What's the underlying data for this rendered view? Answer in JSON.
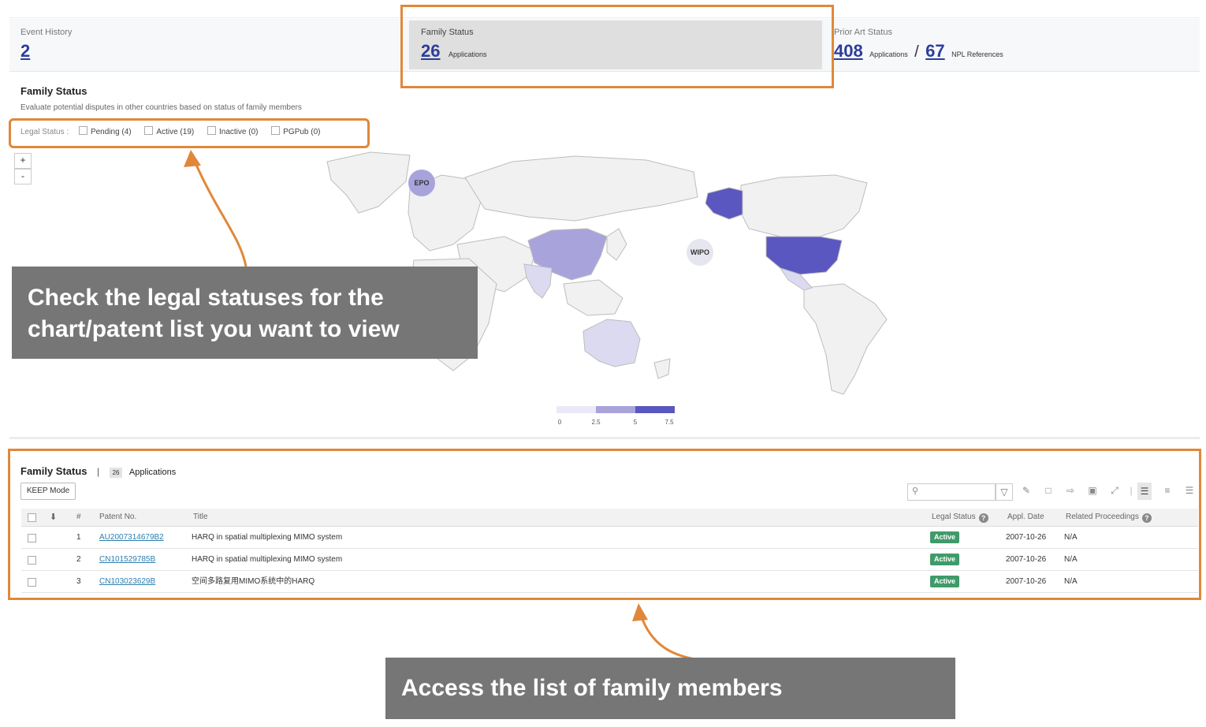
{
  "stats": {
    "event_history": {
      "label": "Event History",
      "value": "2"
    },
    "family_status": {
      "label": "Family Status",
      "value": "26",
      "unit": "Applications"
    },
    "prior_art": {
      "label": "Prior Art Status",
      "apps_value": "408",
      "apps_unit": "Applications",
      "separator": "/",
      "npl_value": "67",
      "npl_unit": "NPL References"
    }
  },
  "section": {
    "title": "Family Status",
    "description": "Evaluate potential disputes in other countries based on status of family members",
    "legal_label": "Legal Status :",
    "filters": [
      "Pending (4)",
      "Active (19)",
      "Inactive (0)",
      "PGPub (0)"
    ]
  },
  "map": {
    "zoom_in": "+",
    "zoom_out": "-",
    "bubbles": [
      "EPO",
      "WIPO"
    ],
    "legend_ticks": [
      "0",
      "2.5",
      "5",
      "7.5"
    ],
    "colors": {
      "high": "#5b57c0",
      "mid": "#a9a3dc",
      "low": "#dcdaf0",
      "none": "#f0f0f0",
      "border": "#bdbdbd"
    }
  },
  "callouts": {
    "legal_line1": "Check the legal statuses for the",
    "legal_line2": "chart/patent list you want to view",
    "family": "Access the list of family members"
  },
  "list": {
    "title": "Family Status",
    "separator": "|",
    "count": "26",
    "count_unit": "Applications",
    "keep_mode": "KEEP Mode",
    "columns": {
      "num": "#",
      "patent": "Patent No.",
      "title": "Title",
      "legal": "Legal Status",
      "date": "Appl. Date",
      "related": "Related Proceedings"
    },
    "rows": [
      {
        "num": "1",
        "patent": "AU2007314679B2",
        "title": "HARQ in spatial multiplexing MIMO system",
        "status": "Active",
        "date": "2007-10-26",
        "related": "N/A"
      },
      {
        "num": "2",
        "patent": "CN101529785B",
        "title": "HARQ in spatial multiplexing MIMO system",
        "status": "Active",
        "date": "2007-10-26",
        "related": "N/A"
      },
      {
        "num": "3",
        "patent": "CN103023629B",
        "title": "空间多路复用MIMO系统中的HARQ",
        "status": "Active",
        "date": "2007-10-26",
        "related": "N/A"
      }
    ]
  },
  "accent_color": "#e0883a"
}
